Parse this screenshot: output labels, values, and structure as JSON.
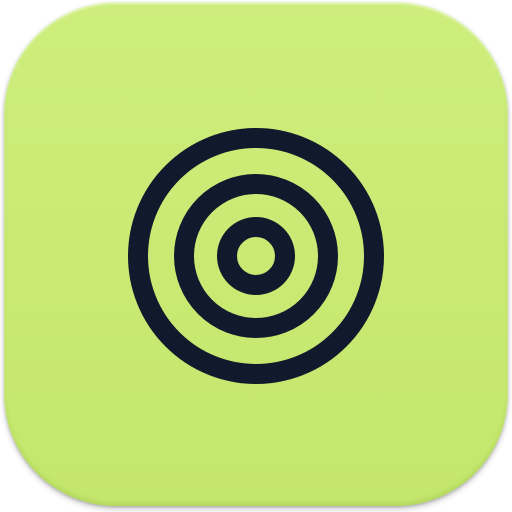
{
  "icon": {
    "name": "target-icon",
    "background_color": "#c8ea73",
    "foreground_color": "#111a2c"
  }
}
